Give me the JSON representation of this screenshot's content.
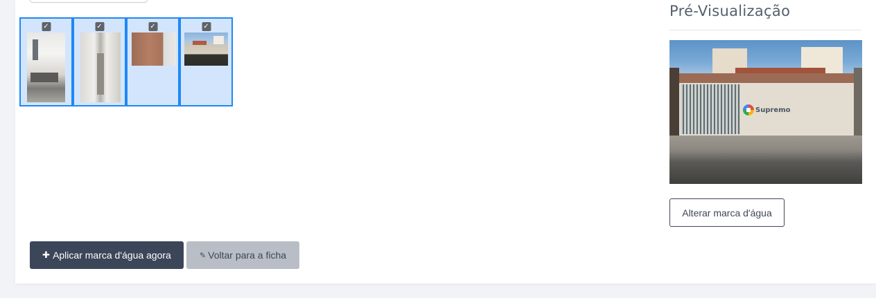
{
  "gallery": {
    "items": [
      {
        "checked": true,
        "checkbox_glyph": "✓",
        "image": "kitchen-tiled-wall-photo"
      },
      {
        "checked": true,
        "checkbox_glyph": "✓",
        "image": "hallway-photo"
      },
      {
        "checked": true,
        "checkbox_glyph": "✓",
        "image": "brick-wall-room-photo"
      },
      {
        "checked": true,
        "checkbox_glyph": "✓",
        "image": "house-facade-photo"
      }
    ],
    "selected_border_color": "#1e88f5",
    "selected_bg_color": "#d3e5fc"
  },
  "preview": {
    "title": "Pré-Visualização",
    "watermark_text": "Supremo",
    "image": "house-facade-with-watermark-photo",
    "change_watermark_button": "Alterar marca d'água"
  },
  "actions": {
    "apply_button": {
      "icon": "plus-icon",
      "glyph": "✚",
      "label": "Aplicar marca d'água agora"
    },
    "back_button": {
      "icon": "paperclip-icon",
      "glyph": "✎",
      "label": "Voltar para a ficha"
    }
  },
  "colors": {
    "primary": "#3b4659",
    "secondary": "#b9bec6",
    "page_bg": "#f2f3f7"
  }
}
